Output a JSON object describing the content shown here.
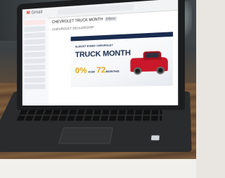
{
  "scene": {
    "description_colors": {
      "desk": "#7b5a3d",
      "laptop": "#1c1d1f",
      "brand_red": "#c8182a",
      "promo_gold": "#e9a421"
    }
  },
  "gmail": {
    "app_name": "Gmail"
  },
  "email": {
    "subject": "CHEVROLET TRUCK MONTH",
    "subject_tag": "Inbox",
    "sender": "CHEVROLET DEALERSHIP"
  },
  "banner": {
    "small_text": "ALMOST EVERY CHEVROLET",
    "title": "TRUCK MONTH",
    "promo_rate": "0%",
    "promo_for": "FOR",
    "promo_months": "72",
    "promo_months_label": "MONTHS"
  }
}
